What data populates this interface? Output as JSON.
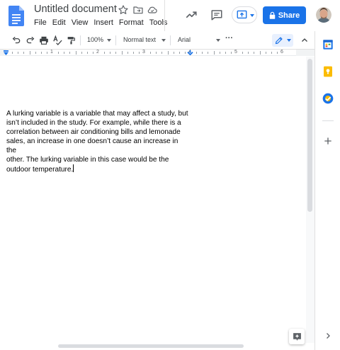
{
  "app": {
    "name": "Google Docs"
  },
  "header": {
    "title": "Untitled document",
    "menu": [
      "File",
      "Edit",
      "View",
      "Insert",
      "Format",
      "Tools"
    ],
    "share_label": "Share"
  },
  "toolbar": {
    "zoom": "100%",
    "style": "Normal text",
    "font": "Arial",
    "more": "···"
  },
  "ruler": {
    "numbers": [
      "1",
      "2",
      "3",
      "4",
      "5",
      "6"
    ]
  },
  "document": {
    "lines": [
      "A lurking variable is a variable that may affect a study, but",
      "isn’t included in the study. For example, while there is a",
      "correlation between air conditioning bills and lemonade",
      "sales, an increase in one doesn’t cause an increase in the",
      "other.  The lurking variable in this case would be the",
      "outdoor temperature."
    ]
  },
  "colors": {
    "docs_blue": "#4285f4",
    "share_blue": "#1a73e8",
    "calendar": "#1a73e8",
    "keep_yellow": "#fbbc04",
    "tasks_blue": "#1a73e8"
  },
  "icons": {
    "star": "star-icon",
    "move": "move-to-folder-icon",
    "cloud": "cloud-status-icon",
    "activity": "activity-dashboard-icon",
    "comment": "comment-history-icon",
    "present": "present-icon",
    "lock": "lock-icon",
    "undo": "undo-icon",
    "redo": "redo-icon",
    "print": "print-icon",
    "spellcheck": "spellcheck-icon",
    "paint_format": "paint-format-icon",
    "edit_mode": "pencil-icon",
    "collapse": "chevron-up-icon",
    "calendar": "calendar-icon",
    "keep": "keep-icon",
    "tasks": "tasks-icon",
    "add": "plus-icon",
    "expand": "chevron-right-icon",
    "explore": "explore-icon"
  }
}
